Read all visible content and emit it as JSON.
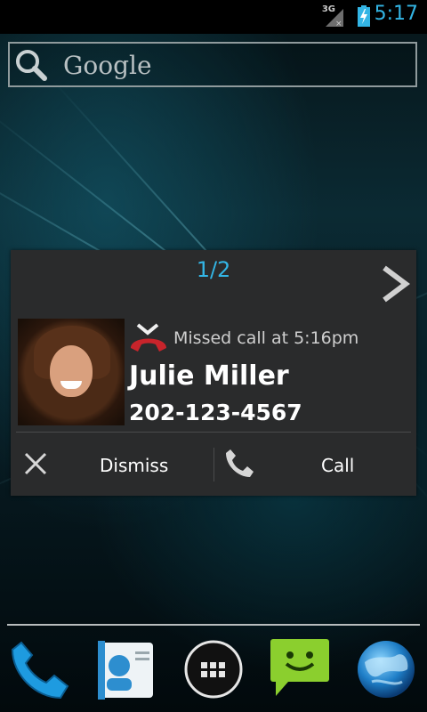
{
  "status_bar": {
    "network_label": "3G",
    "time": "5:17",
    "signal_icon": "signal-icon",
    "battery_icon": "battery-charging-icon"
  },
  "search": {
    "label": "Google",
    "icon": "search-icon"
  },
  "missed_call_widget": {
    "pager": "1/2",
    "next_icon": "chevron-right-icon",
    "missed_text": "Missed call at 5:16pm",
    "contact_name": "Julie Miller",
    "phone_number": "202-123-4567",
    "dismiss_label": "Dismiss",
    "call_label": "Call"
  },
  "dock": {
    "items": [
      {
        "icon": "phone-icon"
      },
      {
        "icon": "contacts-icon"
      },
      {
        "icon": "app-drawer-icon"
      },
      {
        "icon": "messaging-icon"
      },
      {
        "icon": "browser-globe-icon"
      }
    ]
  },
  "colors": {
    "accent": "#33b5e5",
    "card_background": "#2a2b2c",
    "missed_call_red": "#c8242b"
  }
}
